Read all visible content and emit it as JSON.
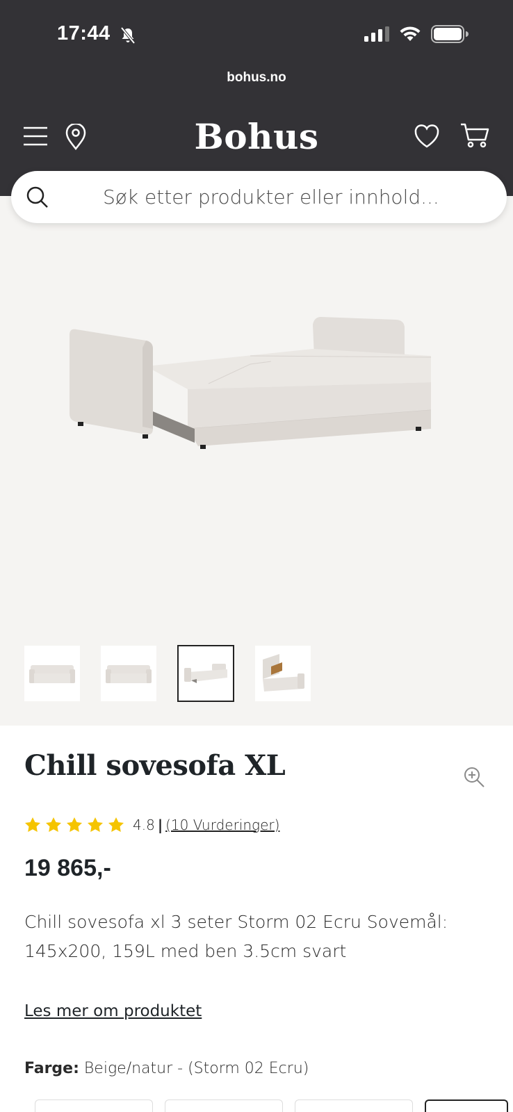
{
  "status_bar": {
    "time": "17:44"
  },
  "browser": {
    "url": "bohus.no"
  },
  "header": {
    "brand": "Bohus"
  },
  "search": {
    "placeholder": "Søk etter produkter eller innhold..."
  },
  "product": {
    "title": "Chill sovesofa XL",
    "rating": {
      "stars": 5,
      "score": "4.8",
      "separator": "|",
      "reviews": "(10 Vurderinger)"
    },
    "price": "19 865,-",
    "description": "Chill sovesofa xl 3 seter Storm 02 Ecru Sovemål: 145x200, 159L med ben 3.5cm svart",
    "read_more": "Les mer om produktet",
    "color_label": "Farge:",
    "color_value": "Beige/natur - (Storm 02 Ecru)"
  },
  "gallery": {
    "thumbnail_count": 4,
    "active_thumbnail": 3
  },
  "colors": {
    "header_bg": "#333236",
    "gallery_bg": "#f5f4f2",
    "star": "#f5c400",
    "text": "#1f2428"
  }
}
